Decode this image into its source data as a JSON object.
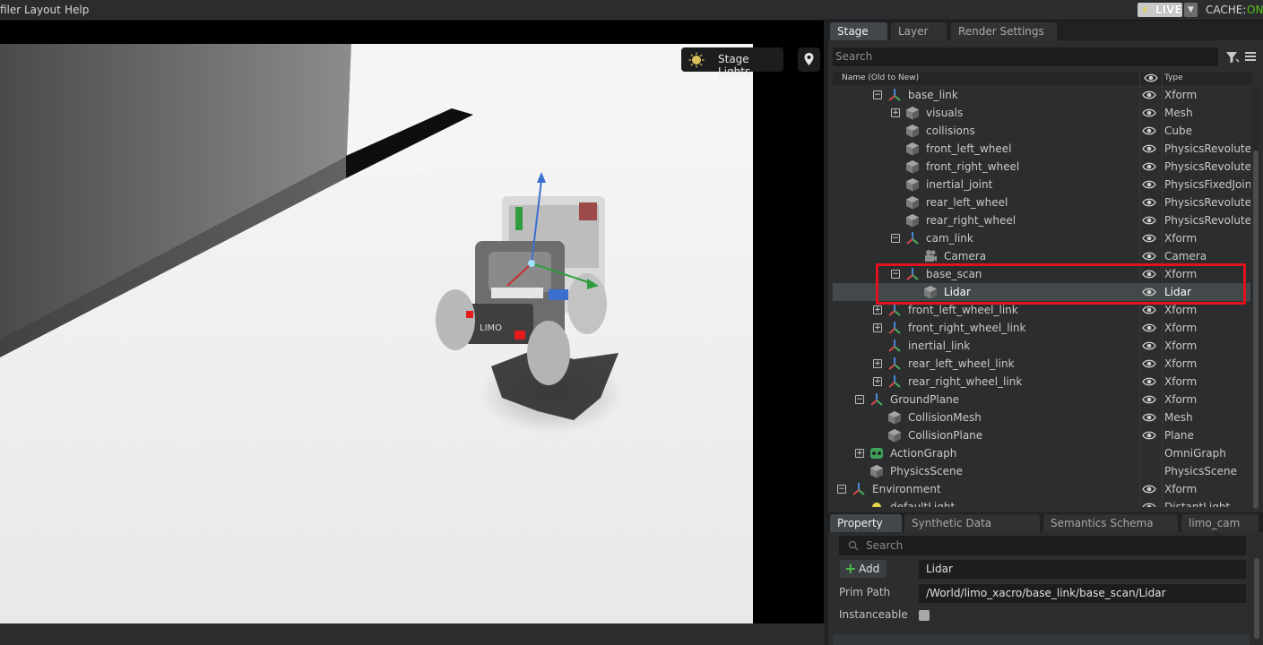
{
  "menu": {
    "items": [
      "filer",
      "Layout",
      "Help"
    ]
  },
  "live": {
    "label": "LIVE",
    "cache_label": "CACHE:",
    "cache_state": "ON",
    "colors": {
      "bolt": "#f5d200",
      "on": "#59c21a"
    }
  },
  "viewport": {
    "stage_lights_label": "Stage Lights",
    "icons": [
      "sun-icon",
      "map-pin-icon"
    ],
    "robot_label": "LIMO"
  },
  "stage_panel": {
    "tabs": [
      "Stage",
      "Layer",
      "Render Settings"
    ],
    "search_placeholder": "Search",
    "columns": {
      "name": "Name (Old to New)",
      "type": "Type"
    },
    "rows": [
      {
        "name": "base_link",
        "type": "Xform",
        "icon": "xform-icon",
        "expander": "minus",
        "depth": 2,
        "eye": true
      },
      {
        "name": "visuals",
        "type": "Mesh",
        "icon": "mesh-icon",
        "expander": "plus",
        "depth": 3,
        "eye": true
      },
      {
        "name": "collisions",
        "type": "Cube",
        "icon": "mesh-icon",
        "expander": "",
        "depth": 3,
        "eye": true
      },
      {
        "name": "front_left_wheel",
        "type": "PhysicsRevolute...",
        "icon": "mesh-icon",
        "expander": "",
        "depth": 3,
        "eye": true
      },
      {
        "name": "front_right_wheel",
        "type": "PhysicsRevolute...",
        "icon": "mesh-icon",
        "expander": "",
        "depth": 3,
        "eye": true
      },
      {
        "name": "inertial_joint",
        "type": "PhysicsFixedJoint",
        "icon": "mesh-icon",
        "expander": "",
        "depth": 3,
        "eye": true
      },
      {
        "name": "rear_left_wheel",
        "type": "PhysicsRevolute...",
        "icon": "mesh-icon",
        "expander": "",
        "depth": 3,
        "eye": true
      },
      {
        "name": "rear_right_wheel",
        "type": "PhysicsRevolute...",
        "icon": "mesh-icon",
        "expander": "",
        "depth": 3,
        "eye": true
      },
      {
        "name": "cam_link",
        "type": "Xform",
        "icon": "xform-icon",
        "expander": "minus",
        "depth": 3,
        "eye": true
      },
      {
        "name": "Camera",
        "type": "Camera",
        "icon": "camera-icon",
        "expander": "",
        "depth": 4,
        "eye": true
      },
      {
        "name": "base_scan",
        "type": "Xform",
        "icon": "xform-icon",
        "expander": "minus",
        "depth": 3,
        "eye": true
      },
      {
        "name": "Lidar",
        "type": "Lidar",
        "icon": "mesh-icon",
        "expander": "",
        "depth": 4,
        "eye": true,
        "selected": true
      },
      {
        "name": "front_left_wheel_link",
        "type": "Xform",
        "icon": "xform-icon",
        "expander": "plus",
        "depth": 2,
        "eye": true
      },
      {
        "name": "front_right_wheel_link",
        "type": "Xform",
        "icon": "xform-icon",
        "expander": "plus",
        "depth": 2,
        "eye": true
      },
      {
        "name": "inertial_link",
        "type": "Xform",
        "icon": "xform-icon",
        "expander": "",
        "depth": 2,
        "eye": true
      },
      {
        "name": "rear_left_wheel_link",
        "type": "Xform",
        "icon": "xform-icon",
        "expander": "plus",
        "depth": 2,
        "eye": true
      },
      {
        "name": "rear_right_wheel_link",
        "type": "Xform",
        "icon": "xform-icon",
        "expander": "plus",
        "depth": 2,
        "eye": true
      },
      {
        "name": "GroundPlane",
        "type": "Xform",
        "icon": "xform-icon",
        "expander": "minus",
        "depth": 1,
        "eye": true
      },
      {
        "name": "CollisionMesh",
        "type": "Mesh",
        "icon": "mesh-icon",
        "expander": "",
        "depth": 2,
        "eye": true
      },
      {
        "name": "CollisionPlane",
        "type": "Plane",
        "icon": "mesh-icon",
        "expander": "",
        "depth": 2,
        "eye": true
      },
      {
        "name": "ActionGraph",
        "type": "OmniGraph",
        "icon": "graph-icon",
        "expander": "plus",
        "depth": 1,
        "eye": false
      },
      {
        "name": "PhysicsScene",
        "type": "PhysicsScene",
        "icon": "mesh-icon",
        "expander": "",
        "depth": 1,
        "eye": false
      },
      {
        "name": "Environment",
        "type": "Xform",
        "icon": "xform-icon",
        "expander": "minus",
        "depth": 0,
        "eye": true
      },
      {
        "name": "defaultLight",
        "type": "DistantLight",
        "icon": "light-icon",
        "expander": "",
        "depth": 1,
        "eye": true
      }
    ],
    "highlight_color": "#e0131f"
  },
  "property_panel": {
    "tabs": [
      "Property",
      "Synthetic Data Recorder",
      "Semantics Schema Edit...",
      "limo_cam"
    ],
    "search_placeholder": "Search",
    "add_label": "Add",
    "name_value": "Lidar",
    "prim_path_label": "Prim Path",
    "prim_path_value": "/World/limo_xacro/base_link/base_scan/Lidar",
    "instanceable_label": "Instanceable",
    "instanceable_checked": false
  }
}
